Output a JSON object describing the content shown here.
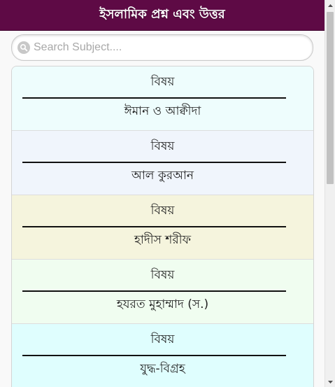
{
  "header": {
    "title": "ইসলামিক প্রশ্ন এবং উত্তর"
  },
  "search": {
    "placeholder": "Search Subject....",
    "value": ""
  },
  "colors": {
    "header_bg": "#5e0a45",
    "header_text": "#ffffff"
  },
  "subjects": [
    {
      "label": "বিষয়",
      "title": "ঈমান ও আক্বীদা",
      "bg": "#eefdfd"
    },
    {
      "label": "বিষয়",
      "title": "আল কুরআন",
      "bg": "#f0f5fc"
    },
    {
      "label": "বিষয়",
      "title": "হাদীস শরীফ",
      "bg": "#f5f4dd"
    },
    {
      "label": "বিষয়",
      "title": "হযরত মুহাম্মাদ (স.)",
      "bg": "#f0fdf0"
    },
    {
      "label": "বিষয়",
      "title": "যুদ্ধ-বিগ্রহ",
      "bg": "#dffefe"
    }
  ],
  "scrollbar": {
    "up_icon": "triangle-up-icon",
    "down_icon": "triangle-down-icon"
  }
}
